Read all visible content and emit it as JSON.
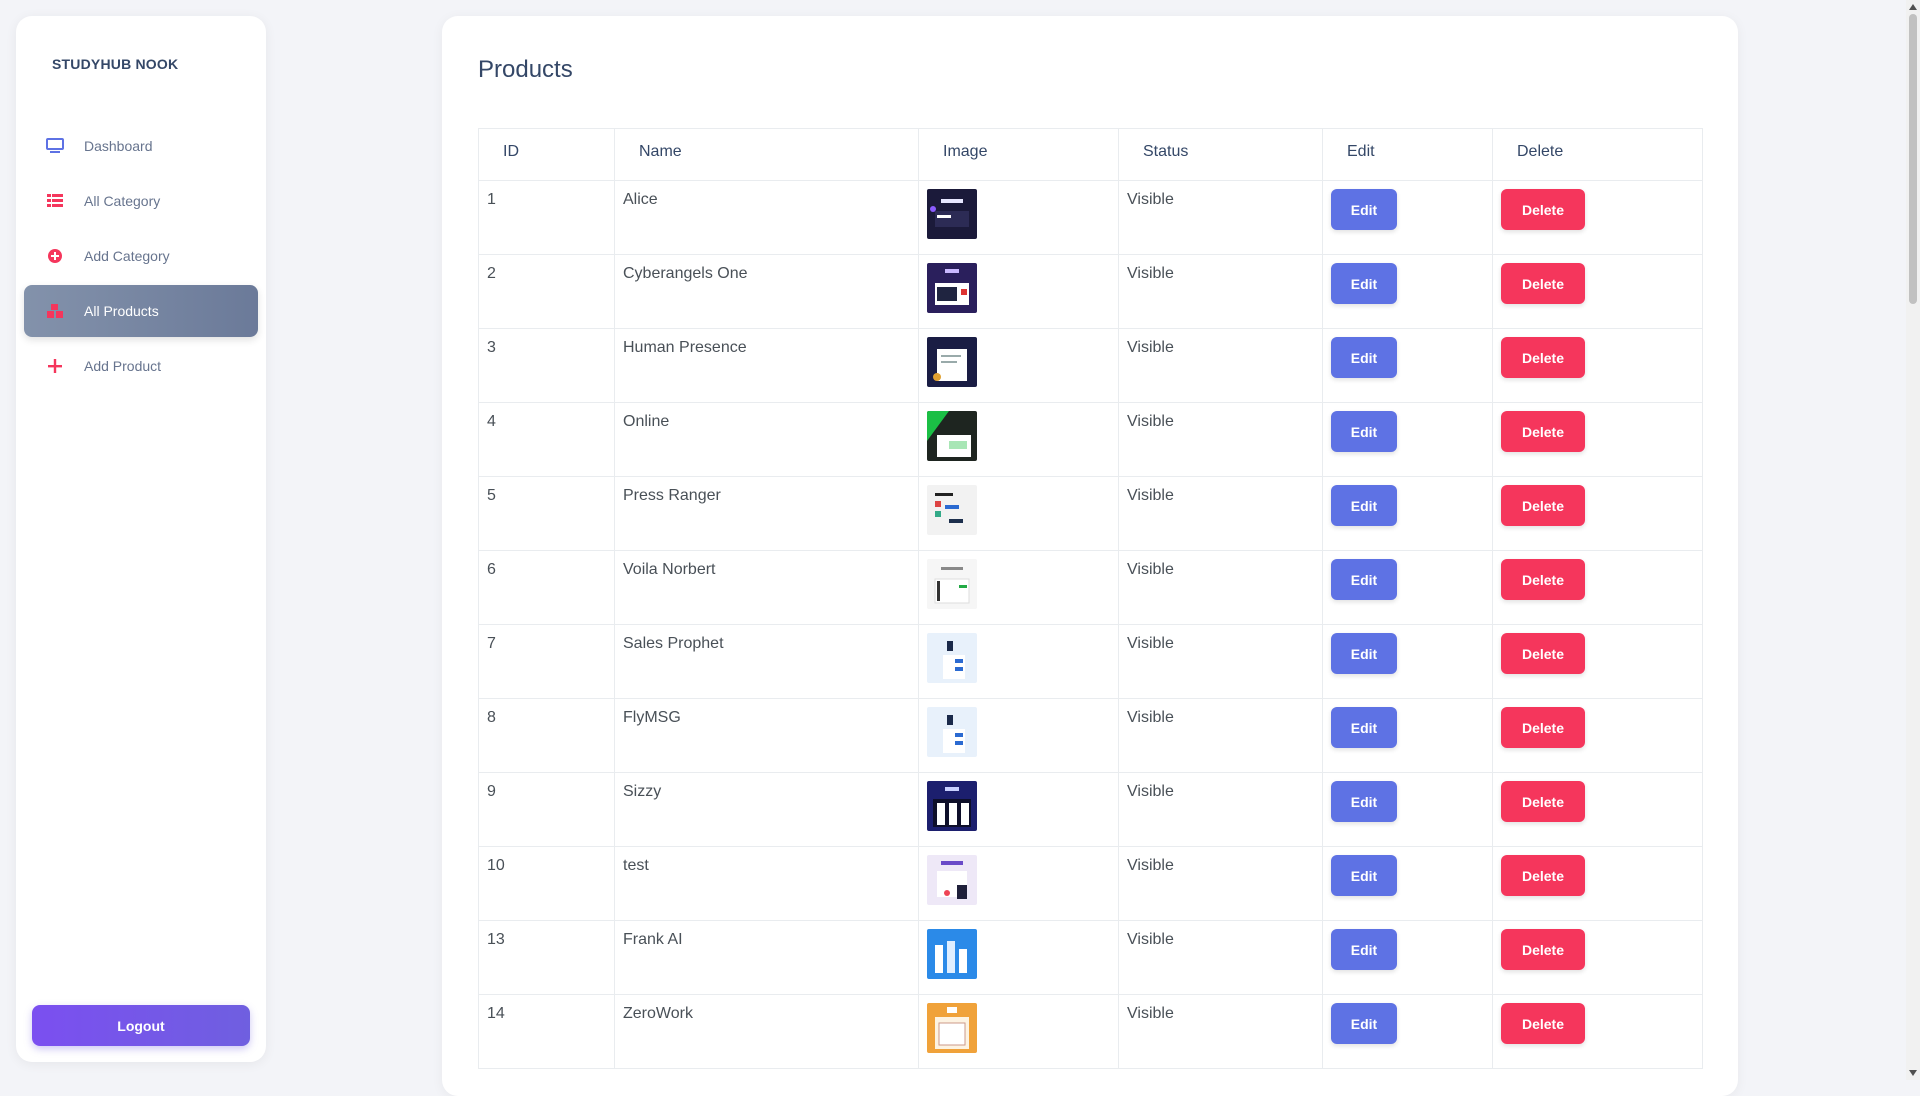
{
  "sidebar": {
    "brand": "STUDYHUB NOOK",
    "items": [
      {
        "label": "Dashboard",
        "icon": "monitor-icon"
      },
      {
        "label": "All Category",
        "icon": "list-icon"
      },
      {
        "label": "Add Category",
        "icon": "plus-circle-icon"
      },
      {
        "label": "All Products",
        "icon": "boxes-icon"
      },
      {
        "label": "Add Product",
        "icon": "plus-icon"
      }
    ],
    "active_item": "All Products",
    "logout_label": "Logout"
  },
  "main": {
    "title": "Products",
    "columns": [
      "ID",
      "Name",
      "Image",
      "Status",
      "Edit",
      "Delete"
    ],
    "edit_label": "Edit",
    "delete_label": "Delete",
    "rows": [
      {
        "id": "1",
        "name": "Alice",
        "status": "Visible"
      },
      {
        "id": "2",
        "name": "Cyberangels One",
        "status": "Visible"
      },
      {
        "id": "3",
        "name": "Human Presence",
        "status": "Visible"
      },
      {
        "id": "4",
        "name": "Online",
        "status": "Visible"
      },
      {
        "id": "5",
        "name": "Press Ranger",
        "status": "Visible"
      },
      {
        "id": "6",
        "name": "Voila Norbert",
        "status": "Visible"
      },
      {
        "id": "7",
        "name": "Sales Prophet",
        "status": "Visible"
      },
      {
        "id": "8",
        "name": "FlyMSG",
        "status": "Visible"
      },
      {
        "id": "9",
        "name": "Sizzy",
        "status": "Visible"
      },
      {
        "id": "10",
        "name": "test",
        "status": "Visible"
      },
      {
        "id": "13",
        "name": "Frank AI",
        "status": "Visible"
      },
      {
        "id": "14",
        "name": "ZeroWork",
        "status": "Visible"
      }
    ]
  },
  "colors": {
    "edit_button": "#5e72e4",
    "delete_button": "#f5365c",
    "logout_button": "#7b4ff0",
    "active_nav": "#8392ab",
    "icon_accent": "#f5365c",
    "dashboard_icon": "#5e72e4"
  }
}
